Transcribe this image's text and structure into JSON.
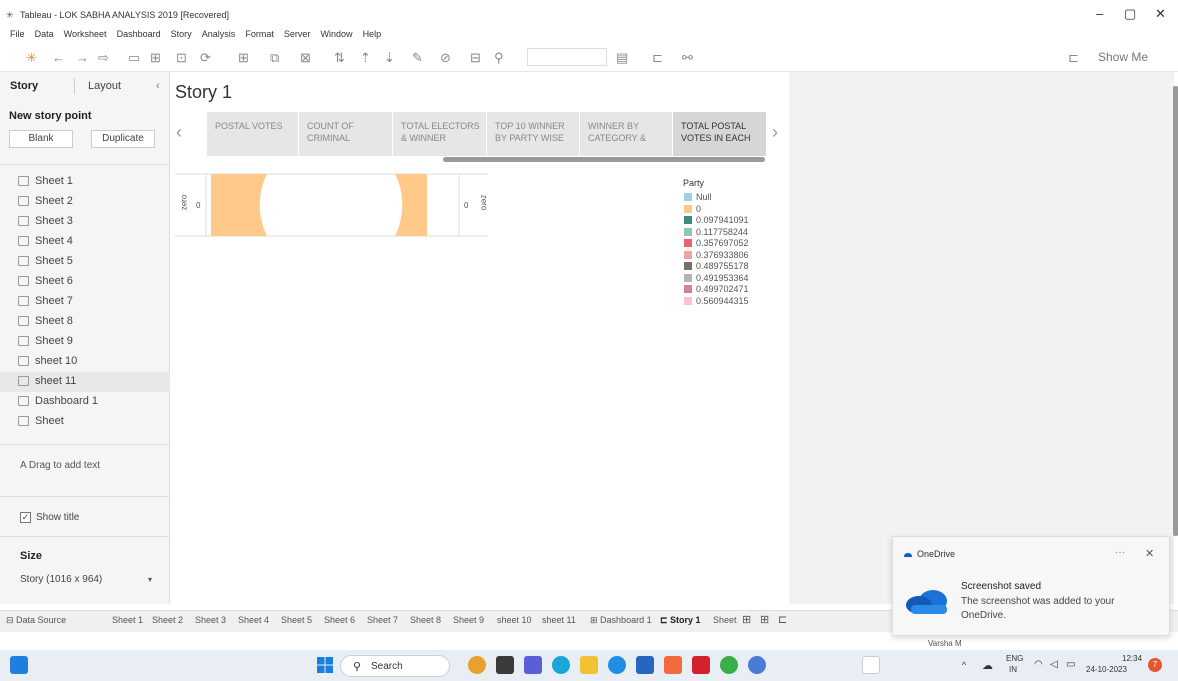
{
  "window": {
    "title": "Tableau - LOK SABHA ANALYSIS 2019 [Recovered]",
    "controls": [
      "–",
      "▢",
      "✕"
    ]
  },
  "menu": [
    "File",
    "Data",
    "Worksheet",
    "Dashboard",
    "Story",
    "Analysis",
    "Format",
    "Server",
    "Window",
    "Help"
  ],
  "toolbar": {
    "show_me": "Show Me"
  },
  "left_panel": {
    "tab_story": "Story",
    "tab_layout": "Layout",
    "collapse": "‹",
    "new_story_point": "New story point",
    "blank": "Blank",
    "duplicate": "Duplicate",
    "sheets": [
      "Sheet 1",
      "Sheet 2",
      "Sheet 3",
      "Sheet 4",
      "Sheet 5",
      "Sheet 6",
      "Sheet 7",
      "Sheet 8",
      "Sheet 9",
      "sheet 10",
      "sheet 11",
      "Dashboard 1",
      "Sheet"
    ],
    "drag_text": "A  Drag to add text",
    "show_title": "Show title",
    "size_header": "Size",
    "size_value": "Story (1016 x 964)"
  },
  "story": {
    "title": "Story 1",
    "points": [
      "POSTAL VOTES",
      "COUNT OF\nCRIMINAL",
      "TOTAL ELECTORS\n& WINNER",
      "TOP 10 WINNER\nBY PARTY WISE",
      "WINNER BY\nCATEGORY &",
      "TOTAL POSTAL\nVOTES IN EACH"
    ],
    "left_axis_label": "zero",
    "left_axis_value": "0",
    "right_axis_value": "0",
    "right_axis_label": "zero"
  },
  "legend": {
    "title": "Party",
    "items": [
      {
        "label": "Null",
        "color": "#a6cee3"
      },
      {
        "label": "0",
        "color": "#ffc98a"
      },
      {
        "label": "0.097941091",
        "color": "#3a8c7a"
      },
      {
        "label": "0.117758244",
        "color": "#8cc4c0"
      },
      {
        "label": "0.357697052",
        "color": "#e8636b"
      },
      {
        "label": "0.376933806",
        "color": "#f7a1a6"
      },
      {
        "label": "0.489755178",
        "color": "#7a716e"
      },
      {
        "label": "0.491953364",
        "color": "#bab2ad"
      },
      {
        "label": "0.499702471",
        "color": "#d67ba1"
      },
      {
        "label": "0.560944315",
        "color": "#f9c3d4"
      }
    ]
  },
  "bottom_tabs": [
    "Data Source",
    "Sheet 1",
    "Sheet 2",
    "Sheet 3",
    "Sheet 4",
    "Sheet 5",
    "Sheet 6",
    "Sheet 7",
    "Sheet 8",
    "Sheet 9",
    "sheet 10",
    "sheet 11",
    "Dashboard 1",
    "Story 1",
    "Sheet"
  ],
  "toast": {
    "app": "OneDrive",
    "heading": "Screenshot saved",
    "body": "The screenshot was added to your OneDrive.",
    "more": "···",
    "close": "✕"
  },
  "user": "Varsha M",
  "taskbar": {
    "search": "Search",
    "lang_top": "ENG",
    "lang_bottom": "IN",
    "time": "12:34",
    "date": "24-10-2023",
    "badge": "7"
  }
}
